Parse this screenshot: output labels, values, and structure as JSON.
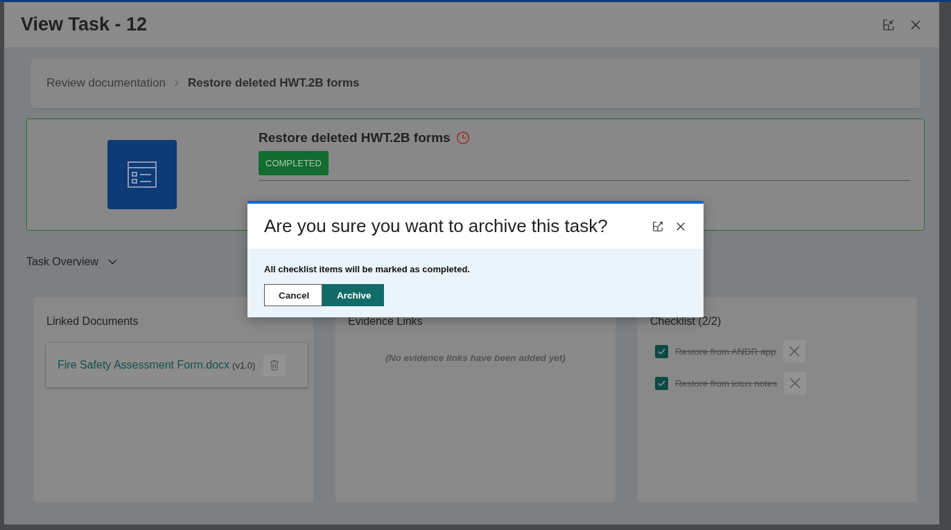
{
  "window": {
    "title": "View Task - 12"
  },
  "breadcrumb": [
    {
      "label": "Review documentation",
      "current": false
    },
    {
      "label": "Restore deleted HWT.2B forms",
      "current": true
    }
  ],
  "task": {
    "title": "Restore deleted HWT.2B forms",
    "status": "COMPLETED"
  },
  "section": {
    "label": "Task Overview",
    "expanded": false
  },
  "linked_documents": {
    "title": "Linked Documents",
    "items": [
      {
        "name": "Fire Safety Assessment Form.docx",
        "version": "(v1.0)"
      }
    ]
  },
  "evidence_links": {
    "title": "Evidence Links",
    "empty_text": "(No evidence links have been added yet)"
  },
  "checklist": {
    "title": "Checklist (2/2)",
    "items": [
      {
        "label": "Restore from ANDR app",
        "checked": true
      },
      {
        "label": "Restore from lotus notes",
        "checked": true
      }
    ]
  },
  "dialog": {
    "title": "Are you sure you want to archive this task?",
    "message": "All checklist items will be marked as completed.",
    "buttons": [
      {
        "label": "Cancel",
        "kind": "secondary"
      },
      {
        "label": "Archive",
        "kind": "primary"
      }
    ]
  }
}
